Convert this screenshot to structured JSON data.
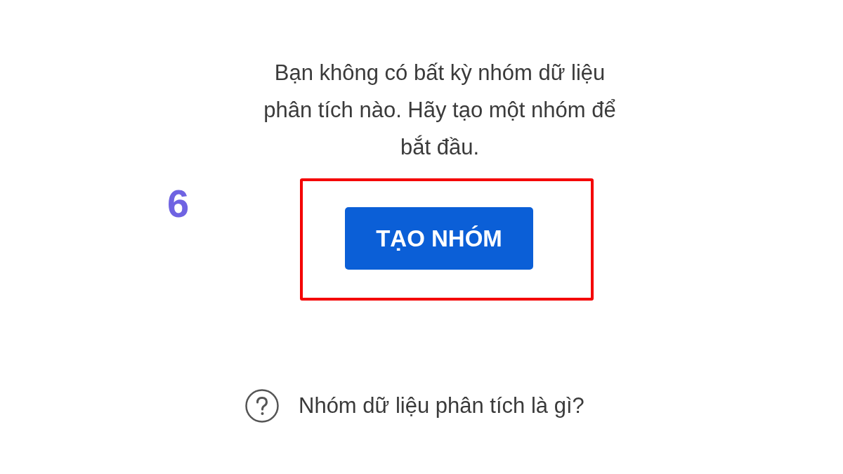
{
  "message": "Bạn không có bất kỳ nhóm dữ liệu phân tích nào. Hãy tạo một nhóm để bắt đầu.",
  "step_marker": "6",
  "create_button": {
    "label": "TẠO NHÓM"
  },
  "help_link": {
    "label": "Nhóm dữ liệu phân tích là gì?"
  }
}
